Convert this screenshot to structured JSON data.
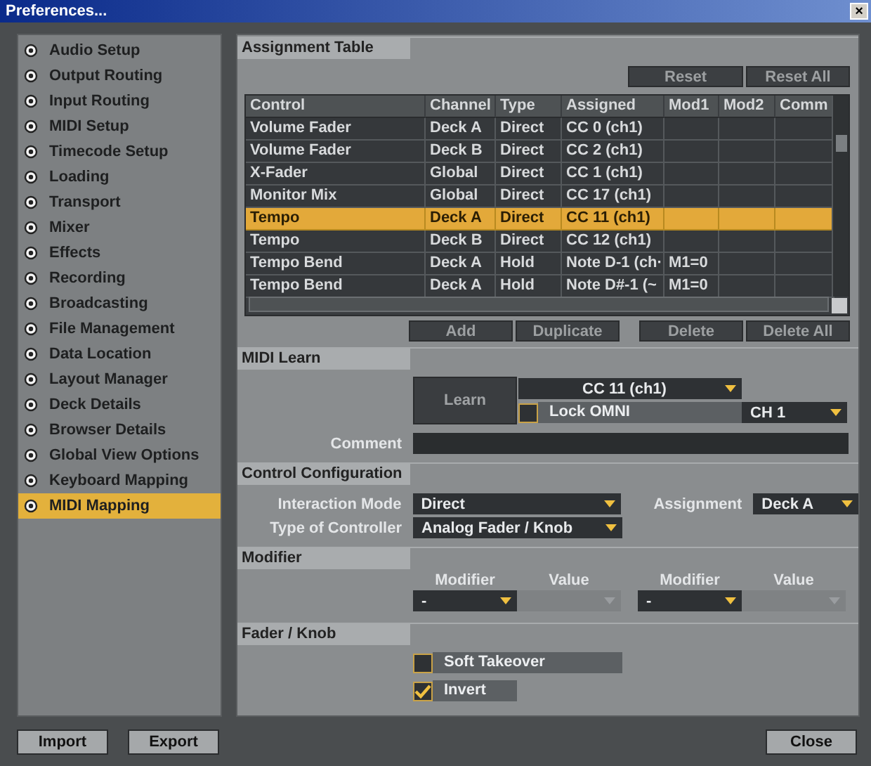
{
  "window": {
    "title": "Preferences...",
    "close": "×"
  },
  "sidebar": {
    "items": [
      {
        "label": "Audio Setup",
        "selected": false
      },
      {
        "label": "Output Routing",
        "selected": false
      },
      {
        "label": "Input Routing",
        "selected": false
      },
      {
        "label": "MIDI Setup",
        "selected": false
      },
      {
        "label": "Timecode Setup",
        "selected": false
      },
      {
        "label": "Loading",
        "selected": false
      },
      {
        "label": "Transport",
        "selected": false
      },
      {
        "label": "Mixer",
        "selected": false
      },
      {
        "label": "Effects",
        "selected": false
      },
      {
        "label": "Recording",
        "selected": false
      },
      {
        "label": "Broadcasting",
        "selected": false
      },
      {
        "label": "File Management",
        "selected": false
      },
      {
        "label": "Data Location",
        "selected": false
      },
      {
        "label": "Layout Manager",
        "selected": false
      },
      {
        "label": "Deck Details",
        "selected": false
      },
      {
        "label": "Browser Details",
        "selected": false
      },
      {
        "label": "Global View Options",
        "selected": false
      },
      {
        "label": "Keyboard Mapping",
        "selected": false
      },
      {
        "label": "MIDI Mapping",
        "selected": true
      }
    ]
  },
  "assignment_table": {
    "heading": "Assignment Table",
    "top_buttons": [
      "Reset",
      "Reset All"
    ],
    "columns": [
      "Control",
      "Channel",
      "Type",
      "Assigned",
      "Mod1",
      "Mod2",
      "Comm"
    ],
    "rows": [
      {
        "cells": [
          "Volume Fader",
          "Deck A",
          "Direct",
          "CC 0 (ch1)",
          "",
          "",
          ""
        ],
        "selected": false
      },
      {
        "cells": [
          "Volume Fader",
          "Deck B",
          "Direct",
          "CC 2 (ch1)",
          "",
          "",
          ""
        ],
        "selected": false
      },
      {
        "cells": [
          "X-Fader",
          "Global",
          "Direct",
          "CC 1 (ch1)",
          "",
          "",
          ""
        ],
        "selected": false
      },
      {
        "cells": [
          "Monitor Mix",
          "Global",
          "Direct",
          "CC 17 (ch1)",
          "",
          "",
          ""
        ],
        "selected": false
      },
      {
        "cells": [
          "Tempo",
          "Deck A",
          "Direct",
          "CC 11 (ch1)",
          "",
          "",
          ""
        ],
        "selected": true
      },
      {
        "cells": [
          "Tempo",
          "Deck B",
          "Direct",
          "CC 12 (ch1)",
          "",
          "",
          ""
        ],
        "selected": false
      },
      {
        "cells": [
          "Tempo Bend",
          "Deck A",
          "Hold",
          "Note D-1 (ch·",
          "M1=0",
          "",
          ""
        ],
        "selected": false
      },
      {
        "cells": [
          "Tempo Bend",
          "Deck A",
          "Hold",
          "Note D#-1 (~",
          "M1=0",
          "",
          ""
        ],
        "selected": false
      }
    ],
    "bottom_buttons": [
      "Add",
      "Duplicate",
      "Delete",
      "Delete All"
    ]
  },
  "midi_learn": {
    "heading": "MIDI Learn",
    "learn_button": "Learn",
    "assigned": "CC 11 (ch1)",
    "lock_omni": {
      "label": "Lock OMNI",
      "checked": false
    },
    "channel": "CH 1",
    "comment_label": "Comment"
  },
  "control_configuration": {
    "heading": "Control Configuration",
    "interaction_mode_label": "Interaction Mode",
    "interaction_mode": "Direct",
    "assignment_label": "Assignment",
    "assignment": "Deck A",
    "controller_type_label": "Type of Controller",
    "controller_type": "Analog Fader / Knob"
  },
  "modifier": {
    "heading": "Modifier",
    "slots": [
      {
        "modifier_label": "Modifier",
        "modifier": "-",
        "value_label": "Value"
      },
      {
        "modifier_label": "Modifier",
        "modifier": "-",
        "value_label": "Value"
      }
    ]
  },
  "fader_knob": {
    "heading": "Fader / Knob",
    "options": [
      {
        "label": "Soft Takeover",
        "checked": false
      },
      {
        "label": "Invert",
        "checked": true
      }
    ]
  },
  "footer": {
    "left_buttons": [
      "Import",
      "Export"
    ],
    "close_button": "Close"
  }
}
